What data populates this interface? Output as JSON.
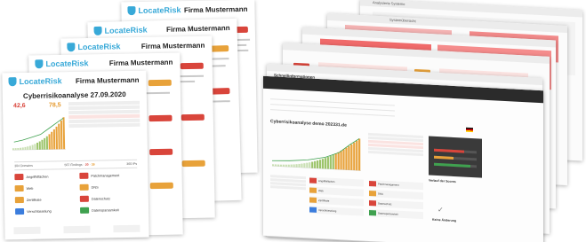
{
  "brand": {
    "logo_text": "LocateRisk",
    "company": "Firma Mustermann",
    "accent": "#38a9d8",
    "danger": "#d9453b",
    "warning": "#e59a2f",
    "ok": "#3fa14f"
  },
  "report_front": {
    "title": "Cyberrisikoanalyse 27.09.2020",
    "score_left": "42,6",
    "score_right": "78,5",
    "summary": {
      "left": "304 Domains",
      "mid_prefix": "567 Findings",
      "mid_red": "20",
      "mid_orange": "39",
      "right": "360 IPs"
    },
    "cards": [
      {
        "color": "red",
        "label": "Angriffsflächen"
      },
      {
        "color": "red",
        "label": "Patchmanagement"
      },
      {
        "color": "orange",
        "label": "Web"
      },
      {
        "color": "orange",
        "label": "DNS"
      },
      {
        "color": "orange",
        "label": "Zertifikate"
      },
      {
        "color": "red",
        "label": "Datenschutz"
      },
      {
        "color": "blue",
        "label": "Verschlüsselung"
      },
      {
        "color": "green",
        "label": "Datensparsamkeit"
      }
    ]
  },
  "screens": {
    "back_title": "Analysierte Systeme",
    "second_title": "Systemübersicht",
    "third_title": "Schnellinformationen",
    "front": {
      "analysis_title": "Cyberrisikoanalyse demo 202331.de",
      "menu": [
        "",
        "",
        ""
      ],
      "history_label": "Verlauf der Scores",
      "no_change_label": "Keine Änderung"
    }
  }
}
